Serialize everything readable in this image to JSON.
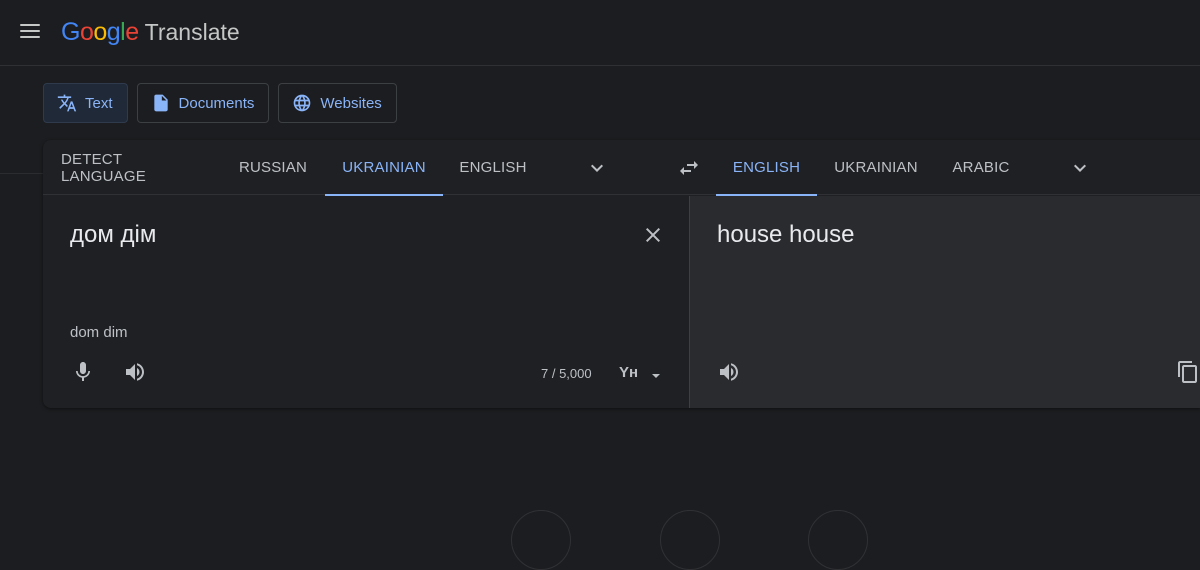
{
  "app": {
    "logo_letters": [
      "G",
      "o",
      "o",
      "g",
      "l",
      "e"
    ],
    "logo_colors": [
      "#4285f4",
      "#ea4335",
      "#fbbc05",
      "#4285f4",
      "#34a853",
      "#ea4335"
    ],
    "product": "Translate"
  },
  "modes": [
    {
      "label": "Text",
      "icon": "translate-icon",
      "active": true
    },
    {
      "label": "Documents",
      "icon": "document-icon",
      "active": false
    },
    {
      "label": "Websites",
      "icon": "globe-icon",
      "active": false
    }
  ],
  "source_langs": [
    "DETECT LANGUAGE",
    "RUSSIAN",
    "UKRAINIAN",
    "ENGLISH"
  ],
  "source_active": "UKRAINIAN",
  "target_langs": [
    "ENGLISH",
    "UKRAINIAN",
    "ARABIC"
  ],
  "target_active": "ENGLISH",
  "source": {
    "text": "дом дім",
    "transliteration": "dom dim",
    "char_count": "7 / 5,000",
    "input_tool": "Yн"
  },
  "target": {
    "text": "house house"
  },
  "colors": {
    "accent": "#8ab4f8",
    "background": "#1c1d20",
    "card": "#1f2023",
    "target_pane": "#2a2b2e"
  }
}
